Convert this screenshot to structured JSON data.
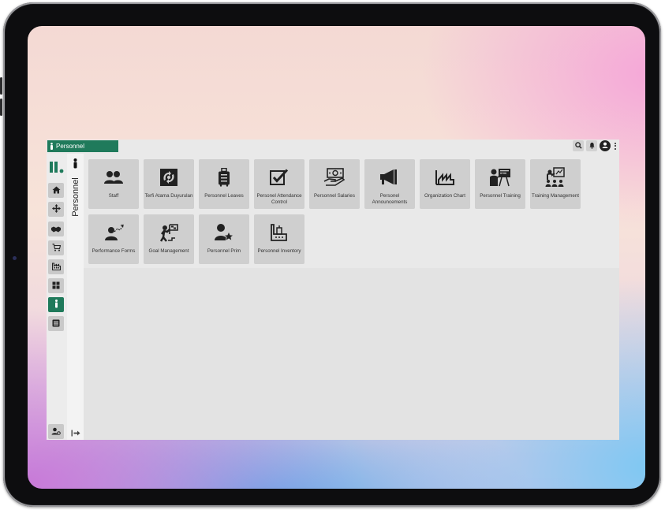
{
  "app": {
    "title": "Personnel",
    "section_label": "Personnel"
  },
  "tiles": [
    {
      "label": "Staff",
      "icon": "people-icon"
    },
    {
      "label": "Terfi Atama Duyurulan",
      "icon": "promotion-icon"
    },
    {
      "label": "Personnel Leaves",
      "icon": "luggage-icon"
    },
    {
      "label": "Personel Attendance Control",
      "icon": "checkbox-icon"
    },
    {
      "label": "Personnel Salaries",
      "icon": "money-hand-icon"
    },
    {
      "label": "Personel Announcements",
      "icon": "megaphone-icon"
    },
    {
      "label": "Organization Chart",
      "icon": "factory-chart-icon"
    },
    {
      "label": "Personnel Training",
      "icon": "presentation-icon"
    },
    {
      "label": "Training Management",
      "icon": "training-board-icon"
    },
    {
      "label": "Performance Forms",
      "icon": "performance-icon"
    },
    {
      "label": "Goal Management",
      "icon": "goal-flag-icon"
    },
    {
      "label": "Personnel Prim",
      "icon": "user-star-icon"
    },
    {
      "label": "Personnel Inventory",
      "icon": "inventory-chair-icon"
    }
  ],
  "nav_icons": [
    "home-icon",
    "move-icon",
    "handshake-icon",
    "cart-icon",
    "factory-icon",
    "grid-icon",
    "person-icon",
    "list-icon",
    "user-settings-icon"
  ],
  "colors": {
    "accent": "#1f7a5b"
  }
}
